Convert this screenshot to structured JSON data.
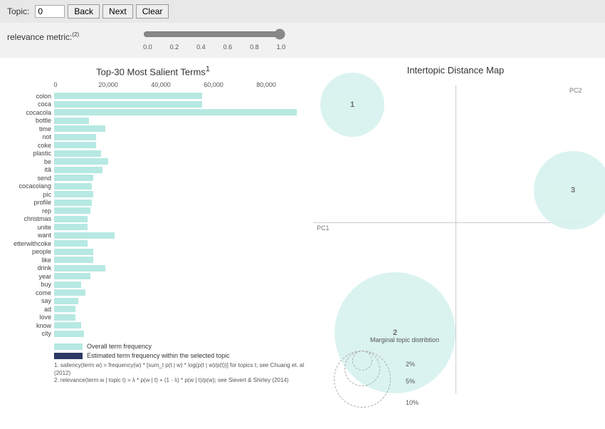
{
  "toolbar": {
    "topic_label": "Topic:",
    "topic_value": "0",
    "back_label": "Back",
    "next_label": "Next",
    "clear_label": "Clear"
  },
  "relevance": {
    "label": "relevance metric:",
    "footref": "(2)",
    "slider_value": "1.0",
    "ticks": [
      "0.0",
      "0.2",
      "0.4",
      "0.6",
      "0.8",
      "1.0"
    ]
  },
  "barpanel": {
    "title": "Top-30 Most Salient Terms",
    "title_sup": "1",
    "x_ticks": [
      {
        "label": "0",
        "pos": 0
      },
      {
        "label": "20,000",
        "pos": 74
      },
      {
        "label": "40,000",
        "pos": 148
      },
      {
        "label": "60,000",
        "pos": 222
      },
      {
        "label": "80,000",
        "pos": 296
      }
    ]
  },
  "legend": {
    "overall": "Overall term frequency",
    "selected": "Estimated term frequency within the selected topic"
  },
  "footnotes": {
    "f1": "1. saliency(term w) = frequency(w) * [sum_t p(t | w) * log(p(t | w)/p(t))] for topics t; see Chuang et. al (2012)",
    "f2": "2. relevance(term w | topic t) = λ * p(w | t) + (1 - λ) * p(w | t)/p(w); see Sievert & Shirley (2014)"
  },
  "mappanel": {
    "title": "Intertopic Distance Map",
    "pc1": "PC1",
    "pc2": "PC2",
    "marginal": "Marginal topic distribtion",
    "scale2": "2%",
    "scale5": "5%",
    "scale10": "10%"
  },
  "topics": {
    "t1": "1",
    "t2": "2",
    "t3": "3"
  },
  "chart_data": {
    "type": "bar",
    "title": "Top-30 Most Salient Terms",
    "xlabel": "",
    "ylabel": "",
    "xlim": [
      0,
      95000
    ],
    "categories": [
      "colon",
      "coca",
      "cocacola",
      "bottle",
      "time",
      "not",
      "coke",
      "plastic",
      "be",
      "itâ",
      "send",
      "cocacolang",
      "pic",
      "profile",
      "rep",
      "christmas",
      "unite",
      "want",
      "etterwithcoke",
      "people",
      "like",
      "drink",
      "year",
      "buy",
      "come",
      "say",
      "ad",
      "love",
      "know",
      "city"
    ],
    "values": [
      55000,
      55000,
      90000,
      13000,
      19000,
      15500,
      15500,
      17500,
      20000,
      18000,
      14500,
      14000,
      14500,
      14000,
      13500,
      12500,
      12500,
      22500,
      12500,
      14500,
      14500,
      19000,
      13500,
      10000,
      11500,
      9000,
      8000,
      8000,
      10000,
      11000
    ],
    "interactive_map": {
      "topics": [
        {
          "id": 1,
          "pc1": -0.6,
          "pc2": 0.85,
          "size_pct": 8
        },
        {
          "id": 2,
          "pc1": -0.35,
          "pc2": -0.8,
          "size_pct": 18
        },
        {
          "id": 3,
          "pc1": 0.95,
          "pc2": 0.2,
          "size_pct": 10
        }
      ]
    }
  }
}
